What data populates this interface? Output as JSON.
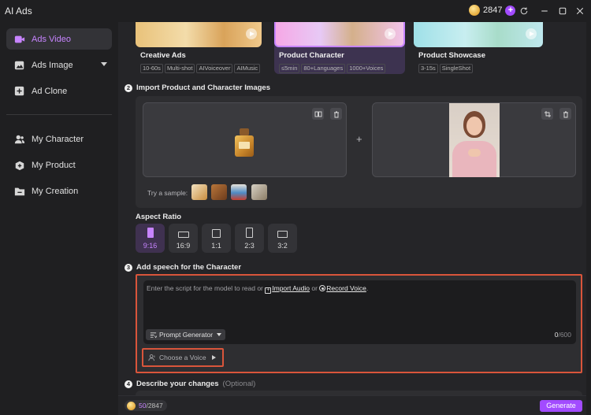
{
  "app": {
    "title": "AI Ads",
    "credits": "2847"
  },
  "sidebar": {
    "items": [
      {
        "label": "Ads Video",
        "icon": "video-icon",
        "active": true
      },
      {
        "label": "Ads Image",
        "icon": "image-icon"
      },
      {
        "label": "Ad Clone",
        "icon": "clone-icon"
      },
      {
        "label": "My Character",
        "icon": "people-icon"
      },
      {
        "label": "My Product",
        "icon": "box-icon"
      },
      {
        "label": "My Creation",
        "icon": "folder-icon"
      }
    ]
  },
  "templates": [
    {
      "name": "Creative Ads",
      "tags": [
        "10-60s",
        "Multi-shot",
        "AIVoiceover",
        "AIMusic"
      ]
    },
    {
      "name": "Product Character",
      "tags": [
        "≤5min",
        "80+Languages",
        "1000+Voices"
      ],
      "selected": true
    },
    {
      "name": "Product Showcase",
      "tags": [
        "3-15s",
        "SingleShot"
      ]
    }
  ],
  "import": {
    "step": "2",
    "title": "Import Product and Character Images",
    "plus": "+",
    "try_sample": "Try a sample:"
  },
  "aspect": {
    "title": "Aspect Ratio",
    "options": [
      "9:16",
      "16:9",
      "1:1",
      "2:3",
      "3:2"
    ],
    "selected": "9:16"
  },
  "speech": {
    "step": "3",
    "title": "Add speech for the Character",
    "placeholder_start": "Enter the script for the model to read or ",
    "import_audio": "Import Audio",
    "or": " or ",
    "record_voice": "Record Voice",
    "period": ".",
    "prompt_generator": "Prompt Generator",
    "counter_current": "0",
    "counter_max": "/600",
    "choose_voice": "Choose a Voice"
  },
  "changes": {
    "step": "4",
    "title": "Describe your changes",
    "optional": "(Optional)"
  },
  "footer": {
    "cost_used": "50",
    "cost_total": "/2847",
    "generate": "Generate"
  },
  "colors": {
    "accent": "#a24bff",
    "highlight": "#d9553b",
    "active_text": "#c784ff"
  }
}
